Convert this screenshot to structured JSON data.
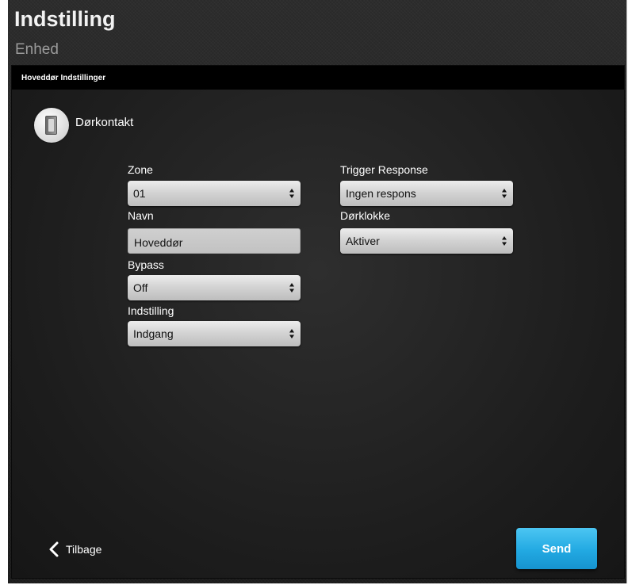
{
  "header": {
    "title": "Indstilling",
    "subtitle": "Enhed"
  },
  "panel": {
    "title": "Hoveddør Indstillinger"
  },
  "device": {
    "name": "Dørkontakt",
    "icon": "door-contact-icon"
  },
  "form": {
    "zone": {
      "label": "Zone",
      "value": "01"
    },
    "name": {
      "label": "Navn",
      "value": "Hoveddør"
    },
    "bypass": {
      "label": "Bypass",
      "value": "Off"
    },
    "setting": {
      "label": "Indstilling",
      "value": "Indgang"
    },
    "trigger_response": {
      "label": "Trigger Response",
      "value": "Ingen respons"
    },
    "doorbell": {
      "label": "Dørklokke",
      "value": "Aktiver"
    }
  },
  "footer": {
    "back_label": "Tilbage",
    "send_label": "Send"
  },
  "colors": {
    "accent": "#22a9e2",
    "panel_header": "#000000",
    "background": "#1f1f1f"
  }
}
